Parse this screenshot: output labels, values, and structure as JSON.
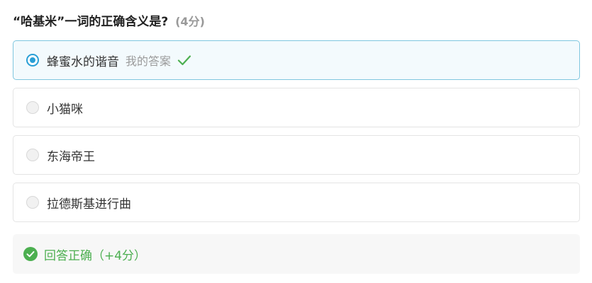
{
  "question": {
    "text": "“哈基米”一词的正确含义是?",
    "score": "(4分)"
  },
  "options": [
    {
      "label": "蜂蜜水的谐音",
      "selected": true,
      "my_answer_label": "我的答案"
    },
    {
      "label": "小猫咪",
      "selected": false
    },
    {
      "label": "东海帝王",
      "selected": false
    },
    {
      "label": "拉德斯基进行曲",
      "selected": false
    }
  ],
  "result": {
    "text": "回答正确（+4分）",
    "color": "#4caf50"
  },
  "colors": {
    "accent": "#2a9fd6",
    "success": "#4caf50"
  }
}
